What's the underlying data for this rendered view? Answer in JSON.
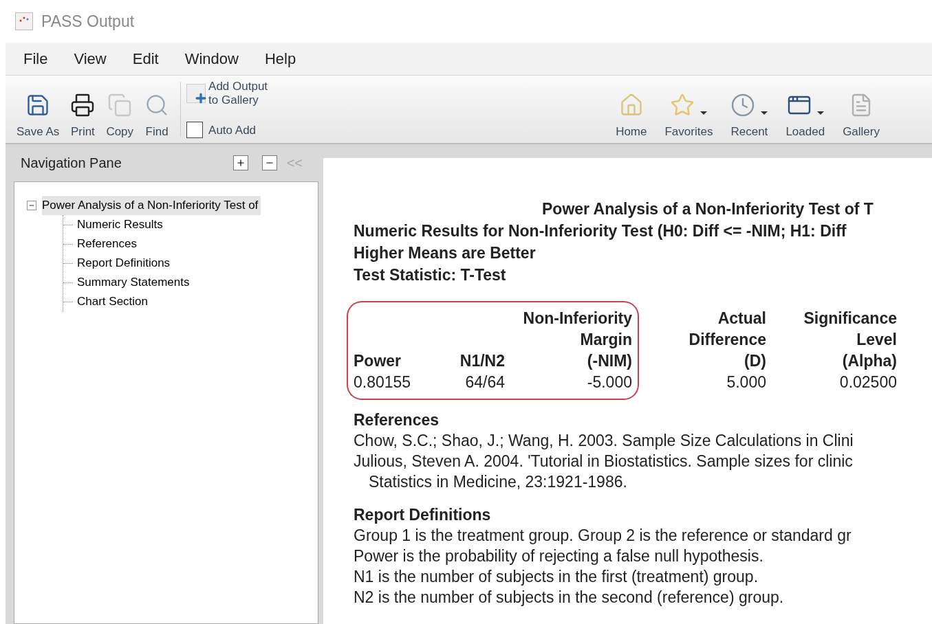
{
  "window": {
    "title": "PASS Output"
  },
  "menu": [
    "File",
    "View",
    "Edit",
    "Window",
    "Help"
  ],
  "toolbar_left": [
    {
      "label": "Save As",
      "kind": "save"
    },
    {
      "label": "Print",
      "kind": "print"
    },
    {
      "label": "Copy",
      "kind": "copy"
    },
    {
      "label": "Find",
      "kind": "find"
    }
  ],
  "gallery_button": {
    "label_lines": [
      "Add Output",
      "to Gallery"
    ]
  },
  "auto_add": {
    "label": "Auto Add",
    "checked": false
  },
  "toolbar_right": [
    {
      "label": "Home",
      "kind": "home",
      "dropdown": false
    },
    {
      "label": "Favorites",
      "kind": "star",
      "dropdown": true
    },
    {
      "label": "Recent",
      "kind": "clock",
      "dropdown": true
    },
    {
      "label": "Loaded",
      "kind": "windows",
      "dropdown": true
    },
    {
      "label": "Gallery",
      "kind": "gallery",
      "dropdown": false
    }
  ],
  "navigation_pane": {
    "title": "Navigation Pane",
    "collapse_label": "<<",
    "tree": [
      {
        "label": "Power Analysis of a Non-Inferiority Test of",
        "expanded": true,
        "selected": true,
        "children": [
          {
            "label": "Numeric Results",
            "selected": false
          },
          {
            "label": "References",
            "selected": false
          },
          {
            "label": "Report Definitions",
            "selected": false
          },
          {
            "label": "Summary Statements",
            "selected": false
          },
          {
            "label": "Chart Section",
            "selected": false
          }
        ]
      }
    ]
  },
  "report": {
    "title": "Power Analysis of a Non-Inferiority Test of T",
    "subtitle_lines": [
      "Numeric Results for Non-Inferiority Test (H0: Diff <= -NIM; H1: Diff",
      "Higher Means are Better",
      "Test Statistic: T-Test"
    ],
    "table": {
      "columns": [
        {
          "header": [
            "Power"
          ],
          "value": "0.80155",
          "highlighted": true
        },
        {
          "header": [
            "N1/N2"
          ],
          "value": "64/64",
          "highlighted": true
        },
        {
          "header": [
            "Non-Inferiority",
            "Margin",
            "(-NIM)"
          ],
          "value": "-5.000",
          "highlighted": true
        },
        {
          "header": [
            "Actual",
            "Difference",
            "(D)"
          ],
          "value": "5.000",
          "highlighted": false
        },
        {
          "header": [
            "Significance",
            "Level",
            "(Alpha)"
          ],
          "value": "0.02500",
          "highlighted": false
        }
      ]
    },
    "sections": [
      {
        "heading": "References",
        "lines": [
          {
            "text": "Chow, S.C.; Shao, J.; Wang, H. 2003. Sample Size Calculations in Clini",
            "indent": false
          },
          {
            "text": "Julious, Steven A. 2004. 'Tutorial in Biostatistics. Sample sizes for clinic",
            "indent": false
          },
          {
            "text": "Statistics in Medicine, 23:1921-1986.",
            "indent": true
          }
        ]
      },
      {
        "heading": "Report Definitions",
        "lines": [
          {
            "text": "Group 1 is the treatment group. Group 2 is the reference or standard gr",
            "indent": false
          },
          {
            "text": "Power is the probability of rejecting a false null hypothesis.",
            "indent": false
          },
          {
            "text": "N1 is the number of subjects in the first (treatment) group.",
            "indent": false
          },
          {
            "text": "N2 is the number of subjects in the second (reference) group.",
            "indent": false
          }
        ]
      }
    ]
  }
}
